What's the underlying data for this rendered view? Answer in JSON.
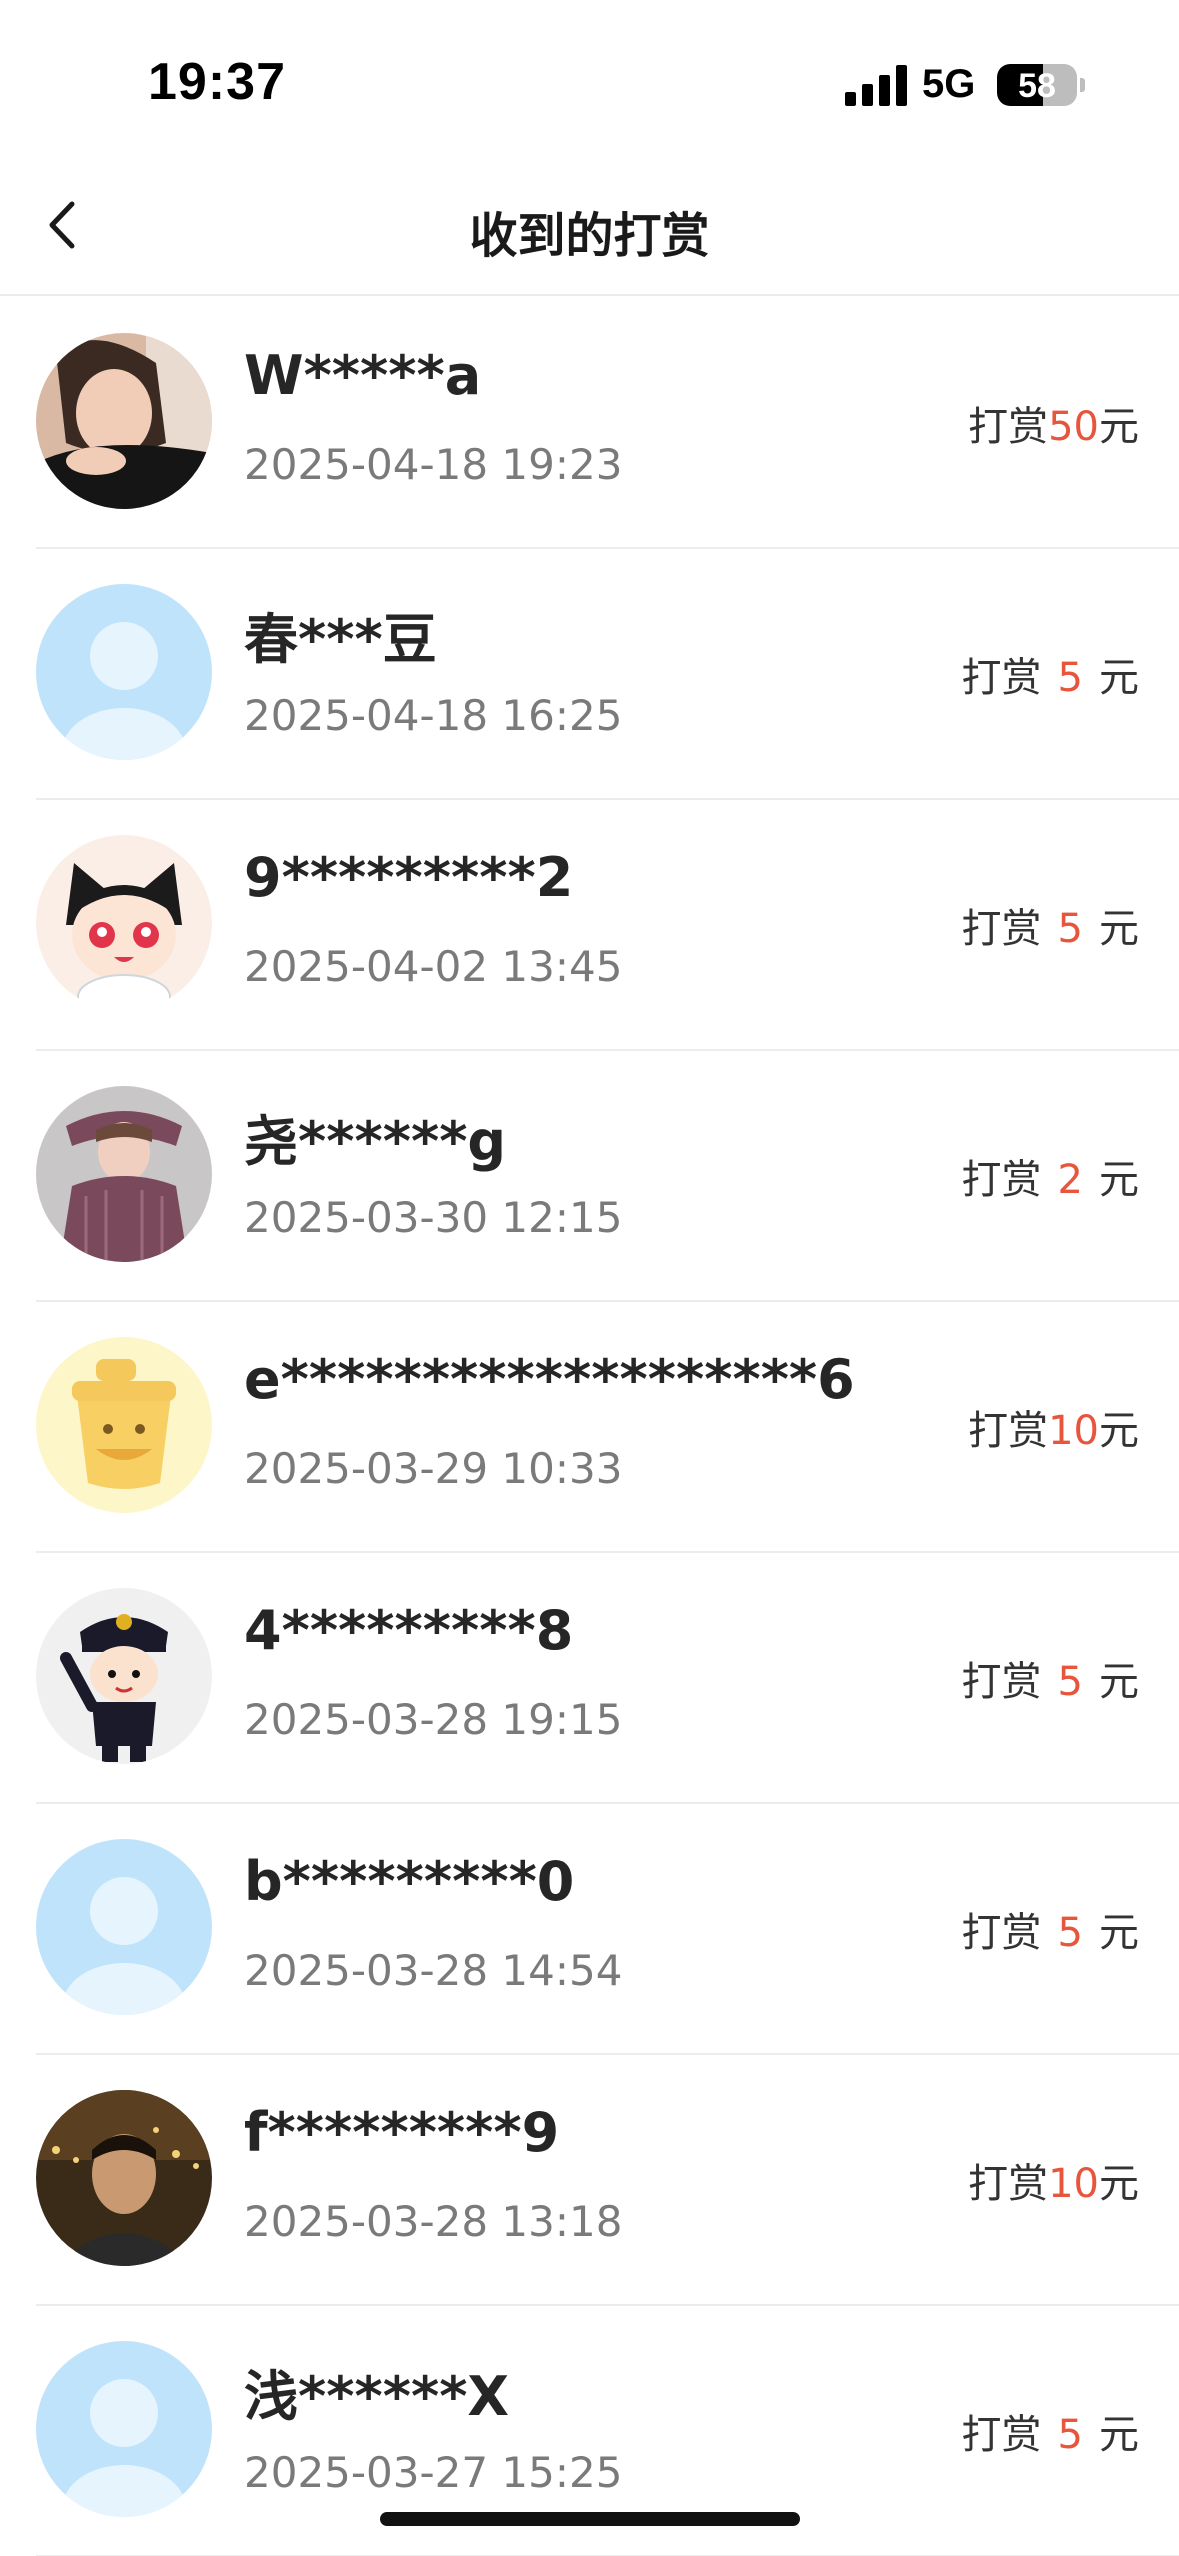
{
  "status_bar": {
    "time": "19:37",
    "network": "5G",
    "battery": "58",
    "battery_level": 0.58
  },
  "nav": {
    "title": "收到的打赏",
    "back_icon": "chevron-left-icon"
  },
  "reward_prefix": "打赏",
  "reward_suffix": "元",
  "records": [
    {
      "name": "W*****a",
      "date": "2025-04-18 19:23",
      "amount": "50",
      "avatar": "photo-woman"
    },
    {
      "name": "春***豆",
      "date": "2025-04-18 16:25",
      "amount": "5",
      "avatar": "default"
    },
    {
      "name": "9*********2",
      "date": "2025-04-02 13:45",
      "amount": "5",
      "avatar": "cartoon-cat-girl"
    },
    {
      "name": "尧******g",
      "date": "2025-03-30 12:15",
      "amount": "2",
      "avatar": "photo-woman-pink"
    },
    {
      "name": "e*******************6",
      "date": "2025-03-29 10:33",
      "amount": "10",
      "avatar": "yellow-cup"
    },
    {
      "name": "4*********8",
      "date": "2025-03-28 19:15",
      "amount": "5",
      "avatar": "cartoon-police"
    },
    {
      "name": "b*********0",
      "date": "2025-03-28 14:54",
      "amount": "5",
      "avatar": "default"
    },
    {
      "name": "f*********9",
      "date": "2025-03-28 13:18",
      "amount": "10",
      "avatar": "photo-man"
    },
    {
      "name": "浅******X",
      "date": "2025-03-27 15:25",
      "amount": "5",
      "avatar": "default"
    }
  ],
  "colors": {
    "accent": "#e8553d",
    "default_avatar": "#bfe3fb"
  }
}
